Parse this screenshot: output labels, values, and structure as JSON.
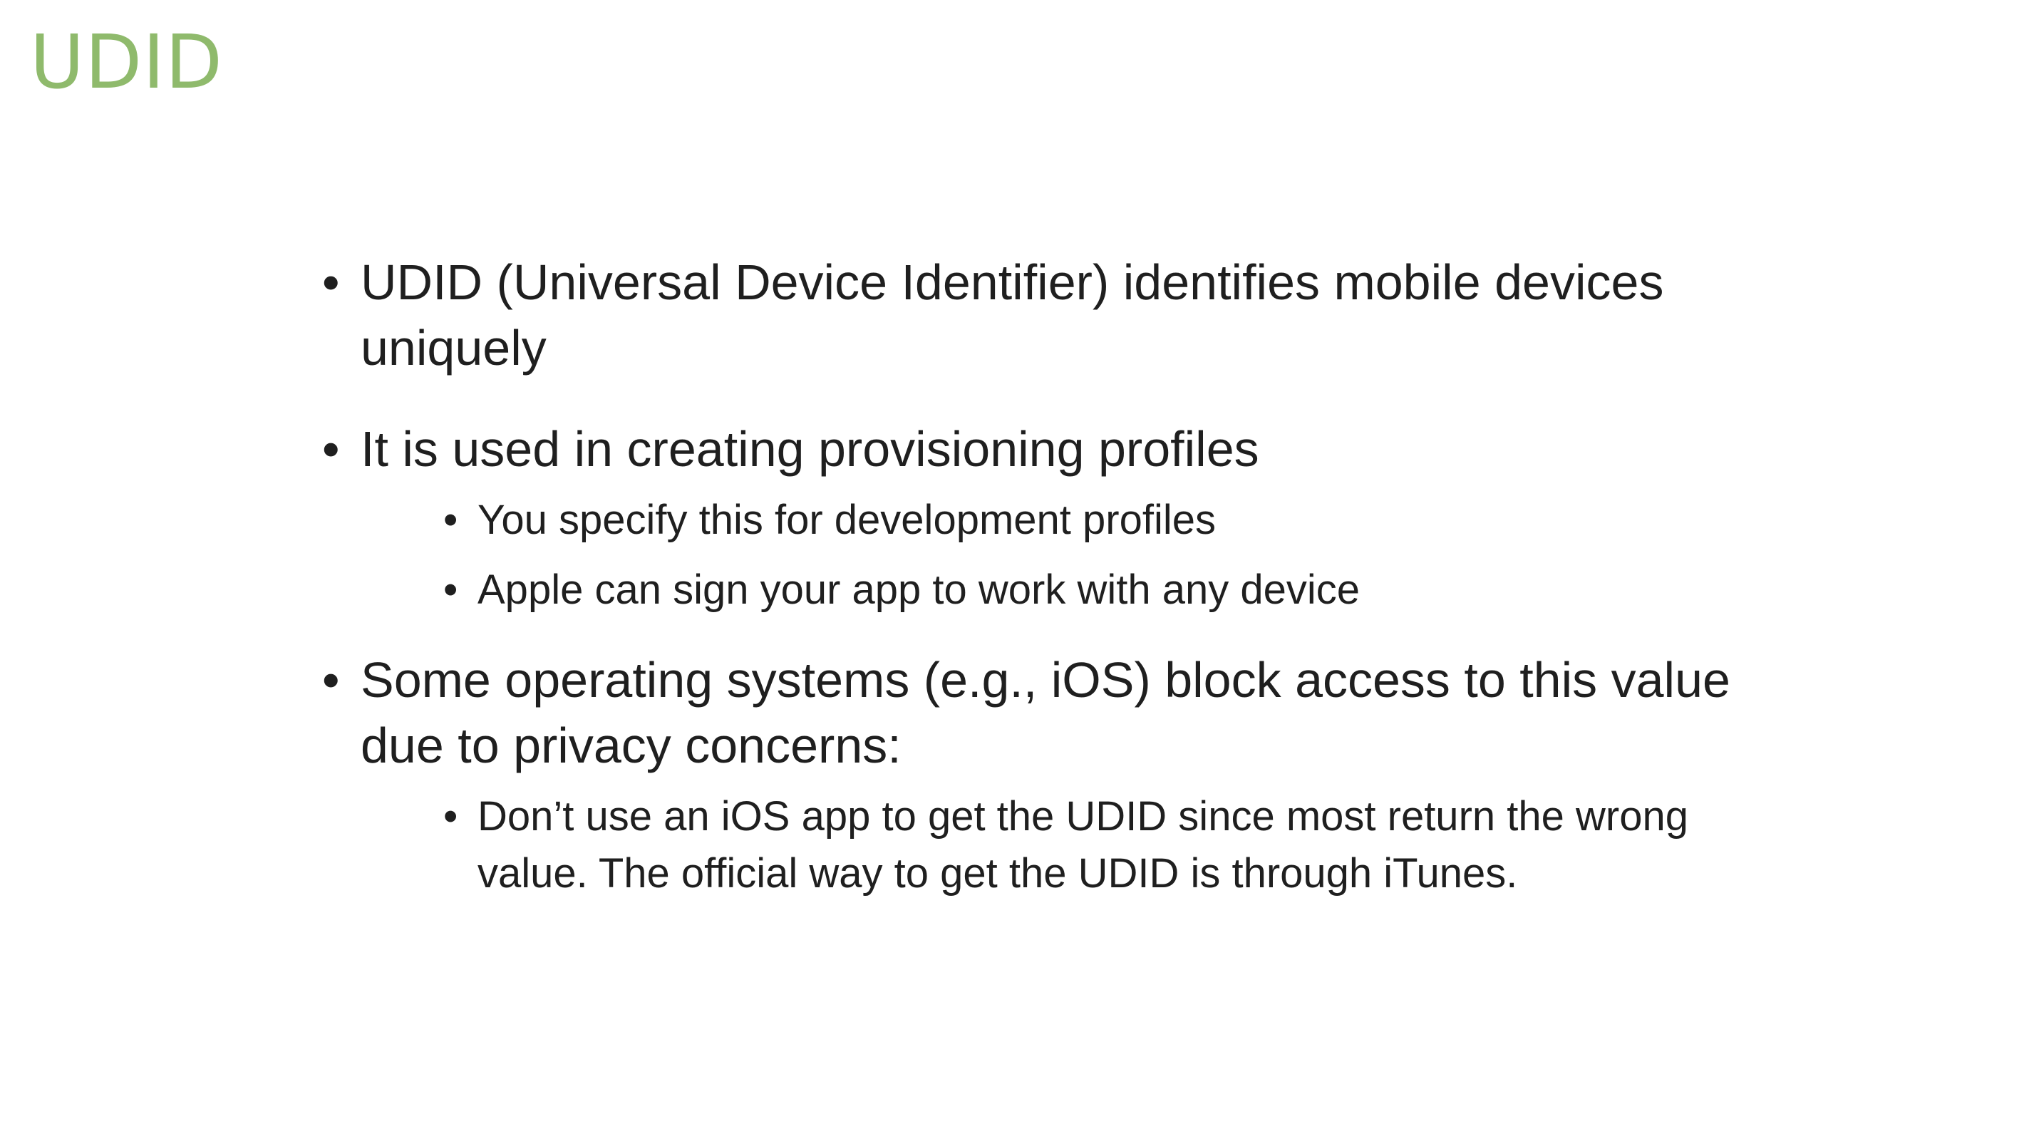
{
  "slide": {
    "title": "UDID",
    "bullets": [
      {
        "text": "UDID (Universal Device Identifier) identifies mobile devices uniquely",
        "sub": []
      },
      {
        "text": "It is used in creating provisioning profiles",
        "sub": [
          "You specify this for development profiles",
          "Apple can sign your app to work with any device"
        ]
      },
      {
        "text": "Some operating systems (e.g., iOS) block access to this value due to privacy concerns:",
        "sub": [
          "Don’t use an iOS app to get the UDID since most return the wrong value. The official way to get the UDID is through iTunes."
        ]
      }
    ]
  },
  "colors": {
    "title": "#8fba6c",
    "body_text": "#1f1f1f",
    "background": "#ffffff"
  }
}
